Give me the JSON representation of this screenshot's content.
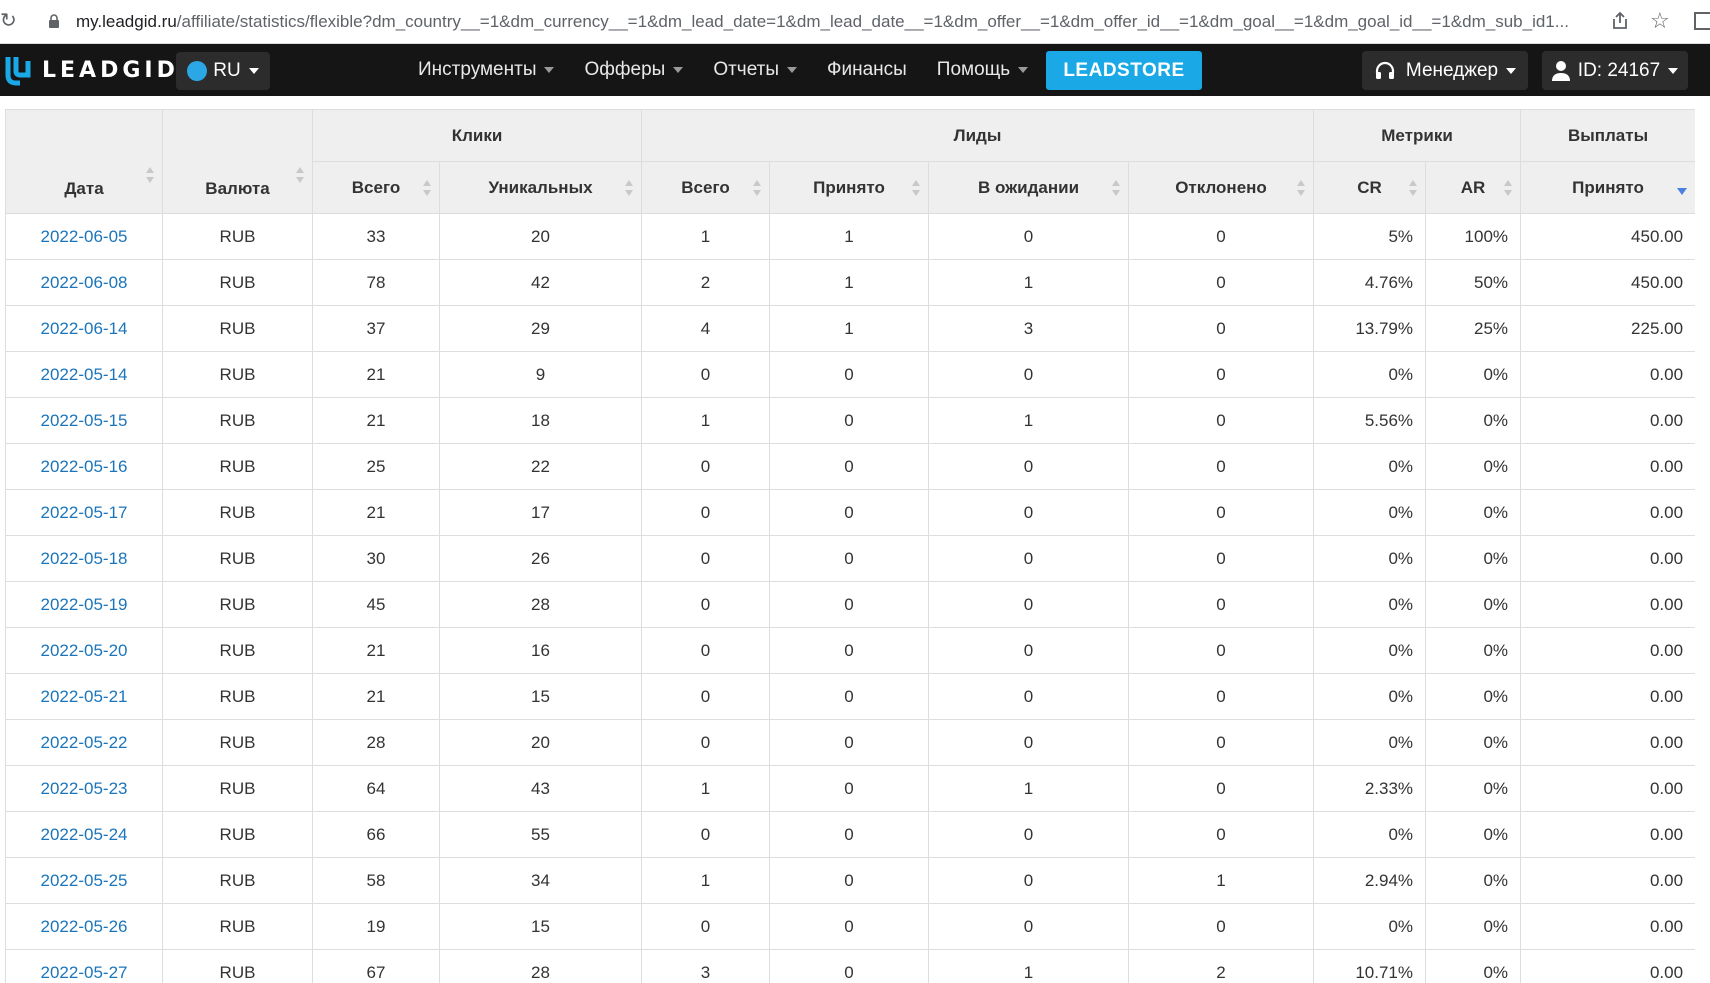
{
  "browser": {
    "url_host": "my.leadgid.ru",
    "url_path": "/affiliate/statistics/flexible?dm_country__=1&dm_currency__=1&dm_lead_date=1&dm_lead_date__=1&dm_offer__=1&dm_offer_id__=1&dm_goal__=1&dm_goal_id__=1&dm_sub_id1..."
  },
  "navbar": {
    "logo_text": "LEADGID",
    "lang": "RU",
    "menu": [
      {
        "label": "Инструменты",
        "dropdown": true
      },
      {
        "label": "Офферы",
        "dropdown": true
      },
      {
        "label": "Отчеты",
        "dropdown": true
      },
      {
        "label": "Финансы",
        "dropdown": false
      },
      {
        "label": "Помощь",
        "dropdown": true
      }
    ],
    "leadstore": "LEADSTORE",
    "manager": "Менеджер",
    "account": "ID: 24167",
    "colors": {
      "bg": "#151515",
      "accent": "#1aa9e6",
      "button": "#2c2c2c"
    }
  },
  "table": {
    "group_headers": {
      "date": "Дата",
      "currency": "Валюта",
      "clicks": "Клики",
      "leads": "Лиды",
      "metrics": "Метрики",
      "payouts": "Выплаты"
    },
    "columns": [
      "Всего",
      "Уникальных",
      "Всего",
      "Принято",
      "В ожидании",
      "Отклонено",
      "CR",
      "AR",
      "Принято"
    ],
    "rows": [
      [
        "2022-06-05",
        "RUB",
        "33",
        "20",
        "1",
        "1",
        "0",
        "0",
        "5%",
        "100%",
        "450.00"
      ],
      [
        "2022-06-08",
        "RUB",
        "78",
        "42",
        "2",
        "1",
        "1",
        "0",
        "4.76%",
        "50%",
        "450.00"
      ],
      [
        "2022-06-14",
        "RUB",
        "37",
        "29",
        "4",
        "1",
        "3",
        "0",
        "13.79%",
        "25%",
        "225.00"
      ],
      [
        "2022-05-14",
        "RUB",
        "21",
        "9",
        "0",
        "0",
        "0",
        "0",
        "0%",
        "0%",
        "0.00"
      ],
      [
        "2022-05-15",
        "RUB",
        "21",
        "18",
        "1",
        "0",
        "1",
        "0",
        "5.56%",
        "0%",
        "0.00"
      ],
      [
        "2022-05-16",
        "RUB",
        "25",
        "22",
        "0",
        "0",
        "0",
        "0",
        "0%",
        "0%",
        "0.00"
      ],
      [
        "2022-05-17",
        "RUB",
        "21",
        "17",
        "0",
        "0",
        "0",
        "0",
        "0%",
        "0%",
        "0.00"
      ],
      [
        "2022-05-18",
        "RUB",
        "30",
        "26",
        "0",
        "0",
        "0",
        "0",
        "0%",
        "0%",
        "0.00"
      ],
      [
        "2022-05-19",
        "RUB",
        "45",
        "28",
        "0",
        "0",
        "0",
        "0",
        "0%",
        "0%",
        "0.00"
      ],
      [
        "2022-05-20",
        "RUB",
        "21",
        "16",
        "0",
        "0",
        "0",
        "0",
        "0%",
        "0%",
        "0.00"
      ],
      [
        "2022-05-21",
        "RUB",
        "21",
        "15",
        "0",
        "0",
        "0",
        "0",
        "0%",
        "0%",
        "0.00"
      ],
      [
        "2022-05-22",
        "RUB",
        "28",
        "20",
        "0",
        "0",
        "0",
        "0",
        "0%",
        "0%",
        "0.00"
      ],
      [
        "2022-05-23",
        "RUB",
        "64",
        "43",
        "1",
        "0",
        "1",
        "0",
        "2.33%",
        "0%",
        "0.00"
      ],
      [
        "2022-05-24",
        "RUB",
        "66",
        "55",
        "0",
        "0",
        "0",
        "0",
        "0%",
        "0%",
        "0.00"
      ],
      [
        "2022-05-25",
        "RUB",
        "58",
        "34",
        "1",
        "0",
        "0",
        "1",
        "2.94%",
        "0%",
        "0.00"
      ],
      [
        "2022-05-26",
        "RUB",
        "19",
        "15",
        "0",
        "0",
        "0",
        "0",
        "0%",
        "0%",
        "0.00"
      ],
      [
        "2022-05-27",
        "RUB",
        "67",
        "28",
        "3",
        "0",
        "1",
        "2",
        "10.71%",
        "0%",
        "0.00"
      ]
    ]
  }
}
